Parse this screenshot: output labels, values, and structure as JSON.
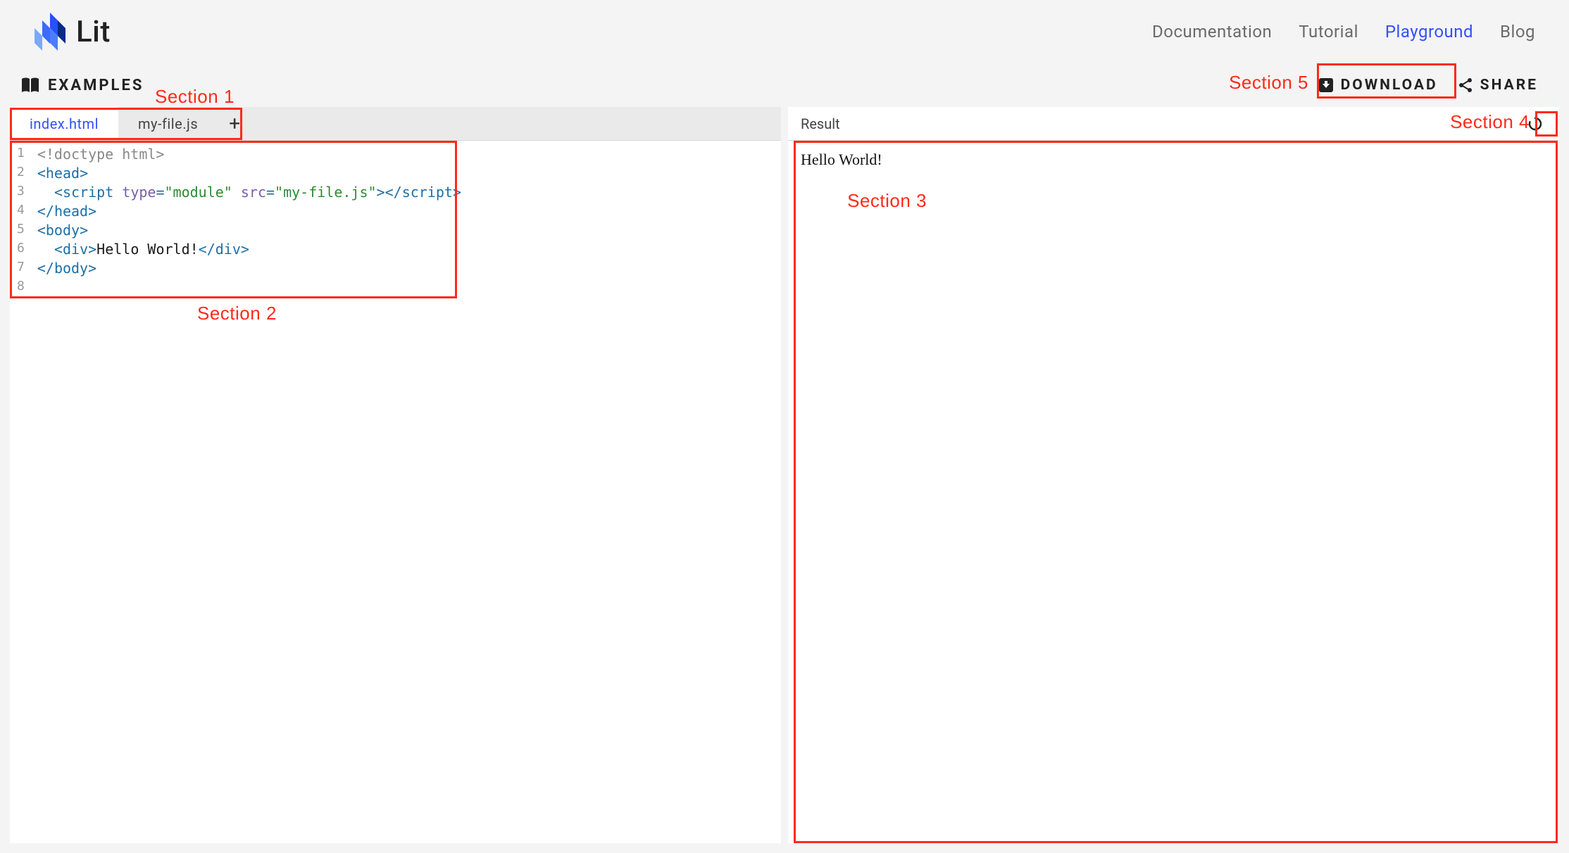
{
  "brand": {
    "name": "Lit"
  },
  "nav": {
    "links": [
      {
        "label": "Documentation",
        "active": false
      },
      {
        "label": "Tutorial",
        "active": false
      },
      {
        "label": "Playground",
        "active": true
      },
      {
        "label": "Blog",
        "active": false
      }
    ]
  },
  "toolbar": {
    "examples_label": "EXAMPLES",
    "download_label": "DOWNLOAD",
    "share_label": "SHARE"
  },
  "tabs": {
    "items": [
      {
        "name": "index.html",
        "active": true
      },
      {
        "name": "my-file.js",
        "active": false
      }
    ],
    "add_glyph": "+"
  },
  "editor": {
    "line_count": 8,
    "lines": [
      {
        "n": 1,
        "tokens": [
          {
            "cls": "tok-decl",
            "t": "<!doctype html>"
          }
        ]
      },
      {
        "n": 2,
        "tokens": [
          {
            "cls": "tok-punc",
            "t": "<"
          },
          {
            "cls": "tok-tag",
            "t": "head"
          },
          {
            "cls": "tok-punc",
            "t": ">"
          }
        ]
      },
      {
        "n": 3,
        "tokens": [
          {
            "cls": "tok-text",
            "t": "  "
          },
          {
            "cls": "tok-punc",
            "t": "<"
          },
          {
            "cls": "tok-tag",
            "t": "script"
          },
          {
            "cls": "tok-text",
            "t": " "
          },
          {
            "cls": "tok-attr",
            "t": "type"
          },
          {
            "cls": "tok-punc",
            "t": "="
          },
          {
            "cls": "tok-val",
            "t": "\"module\""
          },
          {
            "cls": "tok-text",
            "t": " "
          },
          {
            "cls": "tok-attr",
            "t": "src"
          },
          {
            "cls": "tok-punc",
            "t": "="
          },
          {
            "cls": "tok-val",
            "t": "\"my-file.js\""
          },
          {
            "cls": "tok-punc",
            "t": ">"
          },
          {
            "cls": "tok-punc",
            "t": "</"
          },
          {
            "cls": "tok-tag",
            "t": "script"
          },
          {
            "cls": "tok-punc",
            "t": ">"
          }
        ]
      },
      {
        "n": 4,
        "tokens": [
          {
            "cls": "tok-punc",
            "t": "</"
          },
          {
            "cls": "tok-tag",
            "t": "head"
          },
          {
            "cls": "tok-punc",
            "t": ">"
          }
        ]
      },
      {
        "n": 5,
        "tokens": [
          {
            "cls": "tok-punc",
            "t": "<"
          },
          {
            "cls": "tok-tag",
            "t": "body"
          },
          {
            "cls": "tok-punc",
            "t": ">"
          }
        ]
      },
      {
        "n": 6,
        "tokens": [
          {
            "cls": "tok-text",
            "t": "  "
          },
          {
            "cls": "tok-punc",
            "t": "<"
          },
          {
            "cls": "tok-tag",
            "t": "div"
          },
          {
            "cls": "tok-punc",
            "t": ">"
          },
          {
            "cls": "tok-text",
            "t": "Hello World!"
          },
          {
            "cls": "tok-punc",
            "t": "</"
          },
          {
            "cls": "tok-tag",
            "t": "div"
          },
          {
            "cls": "tok-punc",
            "t": ">"
          }
        ]
      },
      {
        "n": 7,
        "tokens": [
          {
            "cls": "tok-punc",
            "t": "</"
          },
          {
            "cls": "tok-tag",
            "t": "body"
          },
          {
            "cls": "tok-punc",
            "t": ">"
          }
        ]
      },
      {
        "n": 8,
        "tokens": []
      }
    ]
  },
  "result": {
    "title": "Result",
    "body": "Hello World!"
  },
  "annotations": {
    "s1": "Section 1",
    "s2": "Section 2",
    "s3": "Section 3",
    "s4": "Section 4",
    "s5": "Section 5"
  }
}
